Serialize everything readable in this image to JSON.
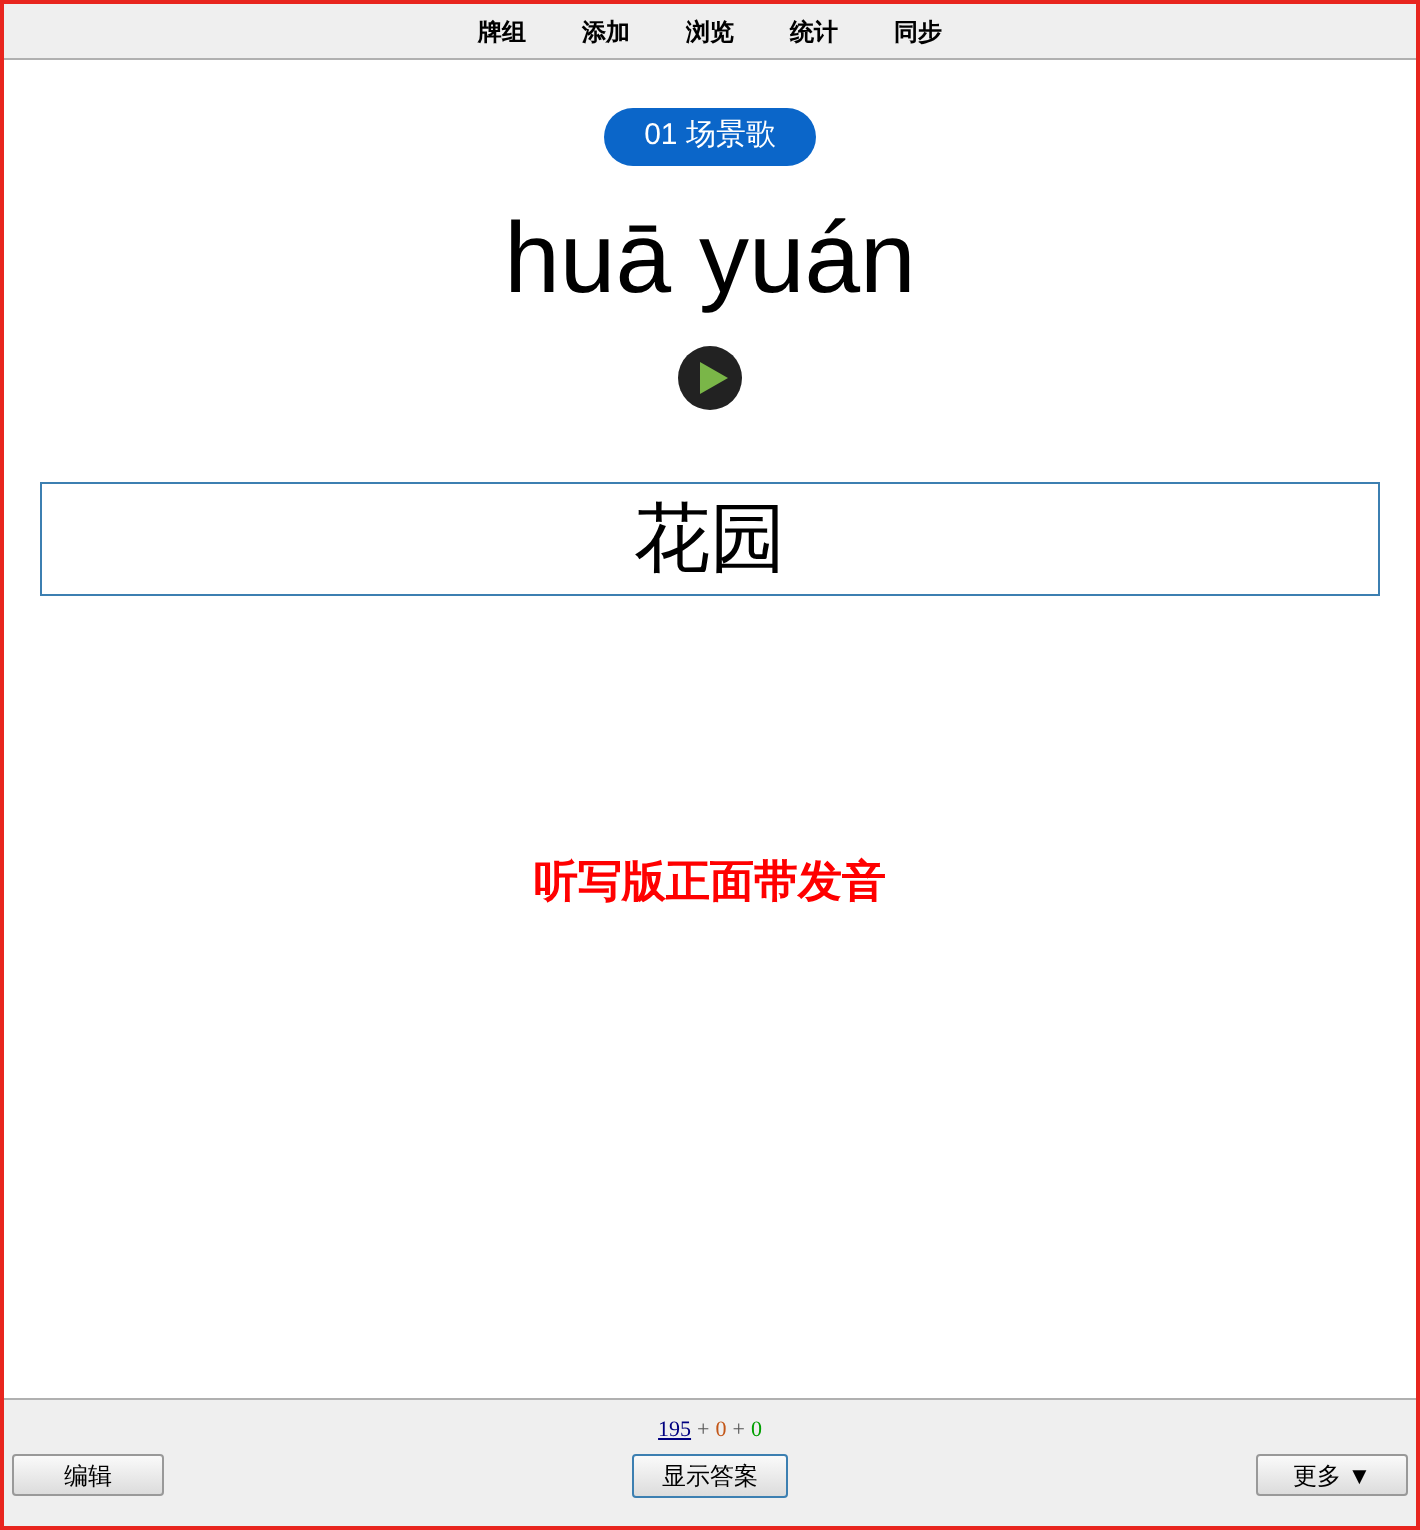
{
  "menu": [
    {
      "label": "牌组"
    },
    {
      "label": "添加"
    },
    {
      "label": "浏览"
    },
    {
      "label": "统计"
    },
    {
      "label": "同步"
    }
  ],
  "card": {
    "deck_tag": "01 场景歌",
    "pinyin": "huā yuán",
    "answer_value": "花园",
    "note": "听写版正面带发音"
  },
  "counts": [
    {
      "value": "195",
      "color": "#000080",
      "kind": "link"
    },
    {
      "value": "0",
      "color": "#c35617",
      "kind": "plain"
    },
    {
      "value": "0",
      "color": "#00a000",
      "kind": "plain"
    }
  ],
  "separators": [
    "+",
    "+"
  ],
  "buttons": {
    "left": "编辑",
    "center": "显示答案",
    "right": "更多 ▼"
  }
}
